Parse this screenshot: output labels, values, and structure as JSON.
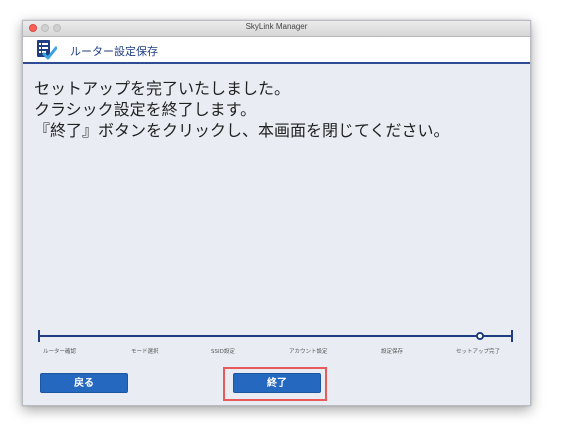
{
  "window": {
    "title": "SkyLink Manager"
  },
  "header": {
    "title": "ルーター設定保存",
    "icon": "settings-checklist-icon",
    "accent_color": "#1f3e82"
  },
  "message": {
    "lines": [
      "セットアップを完了いたしました。",
      "クラシック設定を終了します。",
      "『終了』ボタンをクリックし、本画面を閉じてください。"
    ]
  },
  "progress": {
    "steps": [
      "ルーター確認",
      "モード選択",
      "SSID設定",
      "アカウント設定",
      "設定保存",
      "セットアップ完了"
    ],
    "current_step": "セットアップ完了"
  },
  "buttons": {
    "back_label": "戻る",
    "finish_label": "終了",
    "color": "#2468c0"
  },
  "highlight_color": "#e85a5a"
}
